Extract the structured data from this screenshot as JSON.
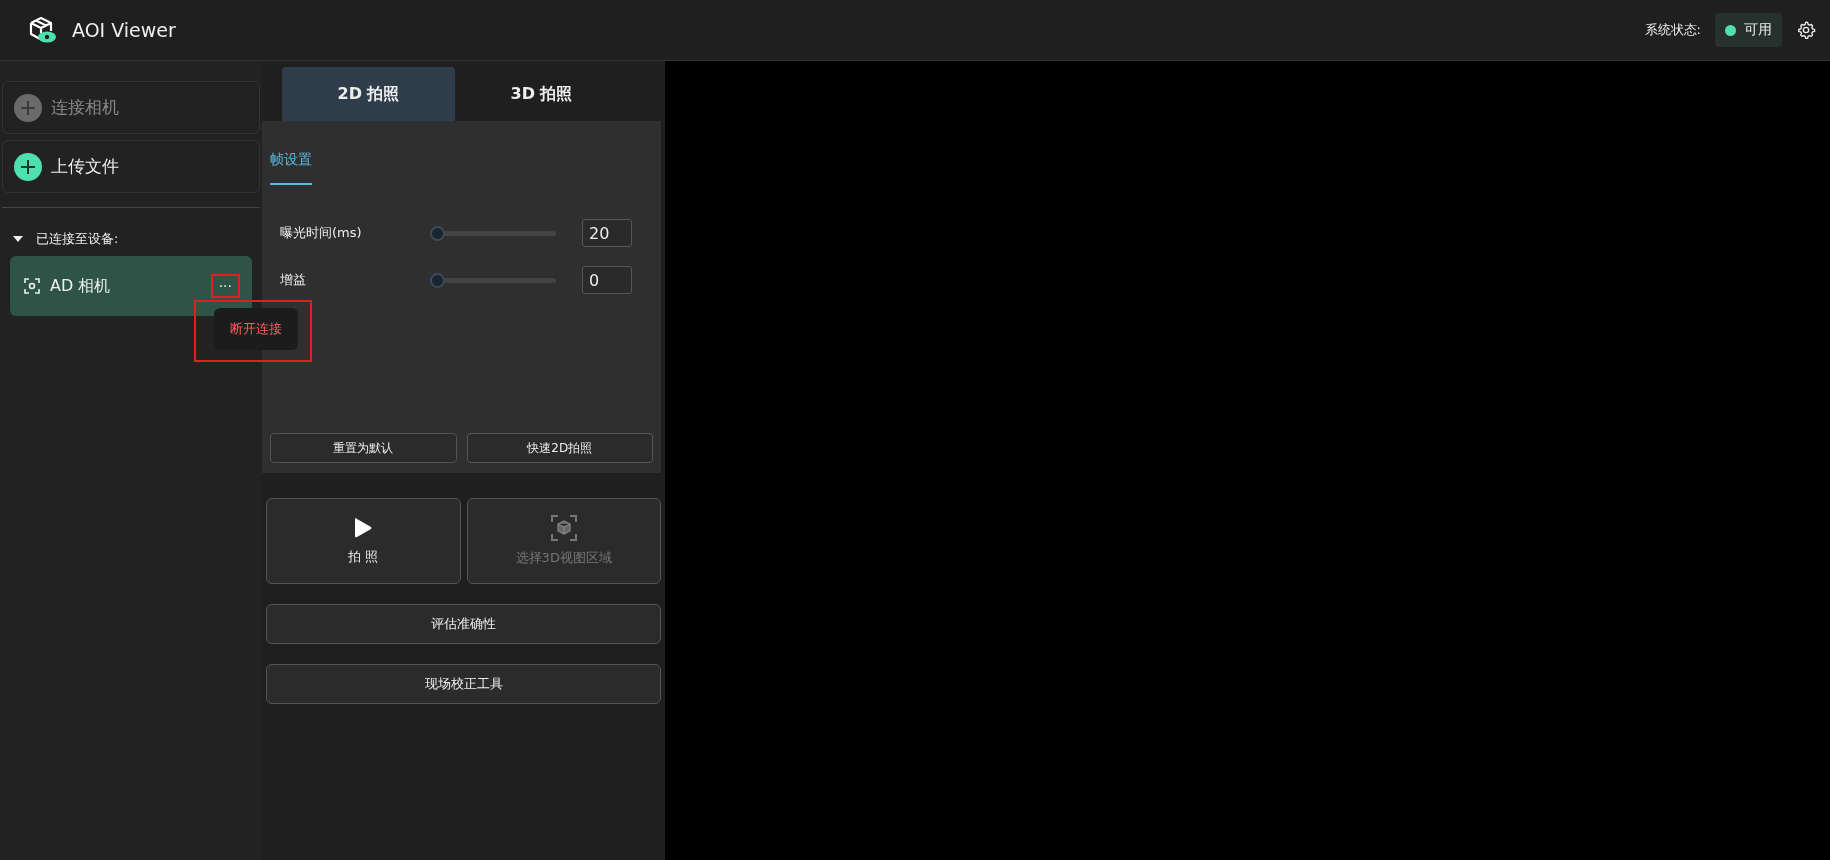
{
  "app": {
    "title": "AOI Viewer",
    "status_label": "系统状态:",
    "status_value": "可用"
  },
  "sidebar": {
    "actions": [
      {
        "label": "连接相机",
        "disabled": true
      },
      {
        "label": "上传文件",
        "disabled": false
      }
    ],
    "devices_heading": "已连接至设备:",
    "devices_expanded": true,
    "devices": [
      {
        "name": "AD 相机",
        "more": "···",
        "selected": true,
        "menu": [
          {
            "label": "断开连接",
            "kind": "danger"
          }
        ]
      }
    ]
  },
  "capture": {
    "tabs": [
      {
        "label": "2D 拍照",
        "selected": true
      },
      {
        "label": "3D 拍照",
        "selected": false
      }
    ],
    "subtabs": [
      {
        "label": "帧设置",
        "selected": true
      }
    ],
    "settings": [
      {
        "label": "曝光时间(ms)",
        "level": 0.0,
        "value": "20"
      },
      {
        "label": "增益",
        "level": 0.0,
        "value": "0"
      }
    ],
    "buttons": [
      "重置为默认",
      "快速2D拍照"
    ],
    "actions": [
      {
        "label": "拍 照",
        "kind": "play",
        "disabled": false
      },
      {
        "label": "选择3D视图区域",
        "kind": "cube",
        "disabled": true
      }
    ],
    "tools": [
      "评估准确性",
      "现场校正工具"
    ]
  }
}
